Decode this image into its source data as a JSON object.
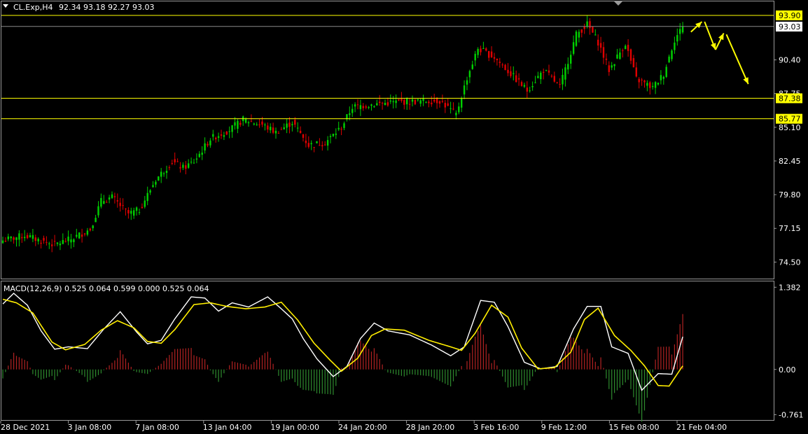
{
  "chart_data": [
    {
      "type": "candlestick",
      "symbol_header": "CL.Exp,H4",
      "ohlc_header": "92.34 93.18 92.27 93.03",
      "current_price": "93.03",
      "y_ticks": [
        "90.40",
        "87.75",
        "85.10",
        "82.45",
        "79.80",
        "77.15",
        "74.50"
      ],
      "ylim": [
        73.2,
        95.0
      ],
      "x_ticks": [
        "28 Dec 2021",
        "3 Jan 08:00",
        "7 Jan 08:00",
        "13 Jan 04:00",
        "19 Jan 00:00",
        "24 Jan 20:00",
        "28 Jan 20:00",
        "3 Feb 16:00",
        "9 Feb 12:00",
        "15 Feb 08:00",
        "21 Feb 04:00"
      ],
      "horizontal_levels": [
        {
          "label": "93.90",
          "value": 93.9
        },
        {
          "label": "87.38",
          "value": 87.38
        },
        {
          "label": "85.77",
          "value": 85.77
        }
      ],
      "close_path": [
        {
          "i": 0,
          "v": 76.2
        },
        {
          "i": 8,
          "v": 76.6
        },
        {
          "i": 15,
          "v": 76.1
        },
        {
          "i": 19,
          "v": 75.9
        },
        {
          "i": 25,
          "v": 76.3
        },
        {
          "i": 32,
          "v": 77.1
        },
        {
          "i": 36,
          "v": 79.3
        },
        {
          "i": 40,
          "v": 79.6
        },
        {
          "i": 46,
          "v": 78.3
        },
        {
          "i": 50,
          "v": 78.6
        },
        {
          "i": 56,
          "v": 81.0
        },
        {
          "i": 62,
          "v": 82.4
        },
        {
          "i": 66,
          "v": 81.9
        },
        {
          "i": 70,
          "v": 82.4
        },
        {
          "i": 76,
          "v": 84.2
        },
        {
          "i": 83,
          "v": 84.9
        },
        {
          "i": 88,
          "v": 85.7
        },
        {
          "i": 95,
          "v": 85.3
        },
        {
          "i": 100,
          "v": 84.7
        },
        {
          "i": 106,
          "v": 85.5
        },
        {
          "i": 112,
          "v": 83.7
        },
        {
          "i": 118,
          "v": 83.9
        },
        {
          "i": 124,
          "v": 85.1
        },
        {
          "i": 128,
          "v": 86.7
        },
        {
          "i": 135,
          "v": 86.9
        },
        {
          "i": 145,
          "v": 87.1
        },
        {
          "i": 160,
          "v": 87.2
        },
        {
          "i": 166,
          "v": 86.1
        },
        {
          "i": 170,
          "v": 89.0
        },
        {
          "i": 174,
          "v": 91.3
        },
        {
          "i": 180,
          "v": 90.6
        },
        {
          "i": 186,
          "v": 89.3
        },
        {
          "i": 192,
          "v": 88.0
        },
        {
          "i": 198,
          "v": 89.6
        },
        {
          "i": 204,
          "v": 88.3
        },
        {
          "i": 210,
          "v": 92.4
        },
        {
          "i": 214,
          "v": 93.2
        },
        {
          "i": 218,
          "v": 91.8
        },
        {
          "i": 222,
          "v": 89.6
        },
        {
          "i": 228,
          "v": 91.7
        },
        {
          "i": 232,
          "v": 88.9
        },
        {
          "i": 238,
          "v": 88.2
        },
        {
          "i": 242,
          "v": 89.3
        },
        {
          "i": 246,
          "v": 92.0
        },
        {
          "i": 249,
          "v": 93.03
        }
      ],
      "annotation_arrows": [
        [
          [
            252,
            92.6
          ],
          [
            256,
            93.4
          ]
        ],
        [
          [
            257,
            93.4
          ],
          [
            261,
            91.2
          ]
        ],
        [
          [
            261,
            91.2
          ],
          [
            264,
            92.5
          ]
        ],
        [
          [
            265,
            92.4
          ],
          [
            273,
            88.5
          ]
        ]
      ]
    },
    {
      "type": "macd",
      "label": "MACD(12,26,9) 0.525 0.064 0.599 0.000 0.525 0.064",
      "y_ticks": [
        "1.382",
        "0.00",
        "-0.761"
      ],
      "ylim": [
        -0.85,
        1.48
      ],
      "macd_line": [
        {
          "i": 0,
          "v": 1.1
        },
        {
          "i": 4,
          "v": 1.28
        },
        {
          "i": 9,
          "v": 1.08
        },
        {
          "i": 14,
          "v": 0.65
        },
        {
          "i": 19,
          "v": 0.34
        },
        {
          "i": 24,
          "v": 0.38
        },
        {
          "i": 31,
          "v": 0.35
        },
        {
          "i": 37,
          "v": 0.68
        },
        {
          "i": 43,
          "v": 0.97
        },
        {
          "i": 49,
          "v": 0.63
        },
        {
          "i": 53,
          "v": 0.43
        },
        {
          "i": 58,
          "v": 0.49
        },
        {
          "i": 63,
          "v": 0.85
        },
        {
          "i": 69,
          "v": 1.22
        },
        {
          "i": 74,
          "v": 1.2
        },
        {
          "i": 79,
          "v": 0.98
        },
        {
          "i": 84,
          "v": 1.12
        },
        {
          "i": 90,
          "v": 1.05
        },
        {
          "i": 97,
          "v": 1.22
        },
        {
          "i": 102,
          "v": 1.02
        },
        {
          "i": 106,
          "v": 0.85
        },
        {
          "i": 110,
          "v": 0.52
        },
        {
          "i": 115,
          "v": 0.18
        },
        {
          "i": 121,
          "v": -0.12
        },
        {
          "i": 126,
          "v": 0.05
        },
        {
          "i": 131,
          "v": 0.52
        },
        {
          "i": 136,
          "v": 0.78
        },
        {
          "i": 141,
          "v": 0.65
        },
        {
          "i": 149,
          "v": 0.58
        },
        {
          "i": 157,
          "v": 0.41
        },
        {
          "i": 164,
          "v": 0.23
        },
        {
          "i": 169,
          "v": 0.38
        },
        {
          "i": 175,
          "v": 1.16
        },
        {
          "i": 180,
          "v": 1.13
        },
        {
          "i": 185,
          "v": 0.72
        },
        {
          "i": 191,
          "v": 0.12
        },
        {
          "i": 197,
          "v": 0.01
        },
        {
          "i": 203,
          "v": 0.05
        },
        {
          "i": 209,
          "v": 0.68
        },
        {
          "i": 214,
          "v": 1.06
        },
        {
          "i": 219,
          "v": 1.06
        },
        {
          "i": 223,
          "v": 0.38
        },
        {
          "i": 229,
          "v": 0.27
        },
        {
          "i": 234,
          "v": -0.35
        },
        {
          "i": 240,
          "v": -0.07
        },
        {
          "i": 245,
          "v": -0.08
        },
        {
          "i": 249,
          "v": 0.55
        }
      ],
      "signal_line": [
        {
          "i": 0,
          "v": 1.18
        },
        {
          "i": 5,
          "v": 1.12
        },
        {
          "i": 11,
          "v": 0.95
        },
        {
          "i": 18,
          "v": 0.46
        },
        {
          "i": 23,
          "v": 0.33
        },
        {
          "i": 30,
          "v": 0.42
        },
        {
          "i": 36,
          "v": 0.66
        },
        {
          "i": 42,
          "v": 0.82
        },
        {
          "i": 48,
          "v": 0.7
        },
        {
          "i": 53,
          "v": 0.47
        },
        {
          "i": 58,
          "v": 0.44
        },
        {
          "i": 63,
          "v": 0.67
        },
        {
          "i": 70,
          "v": 1.09
        },
        {
          "i": 76,
          "v": 1.12
        },
        {
          "i": 82,
          "v": 1.06
        },
        {
          "i": 89,
          "v": 1.02
        },
        {
          "i": 96,
          "v": 1.05
        },
        {
          "i": 102,
          "v": 1.13
        },
        {
          "i": 108,
          "v": 0.83
        },
        {
          "i": 114,
          "v": 0.44
        },
        {
          "i": 120,
          "v": 0.15
        },
        {
          "i": 124,
          "v": -0.03
        },
        {
          "i": 130,
          "v": 0.19
        },
        {
          "i": 135,
          "v": 0.57
        },
        {
          "i": 140,
          "v": 0.68
        },
        {
          "i": 147,
          "v": 0.66
        },
        {
          "i": 156,
          "v": 0.49
        },
        {
          "i": 164,
          "v": 0.38
        },
        {
          "i": 168,
          "v": 0.32
        },
        {
          "i": 173,
          "v": 0.61
        },
        {
          "i": 179,
          "v": 1.08
        },
        {
          "i": 185,
          "v": 0.88
        },
        {
          "i": 190,
          "v": 0.36
        },
        {
          "i": 196,
          "v": 0.01
        },
        {
          "i": 202,
          "v": 0.03
        },
        {
          "i": 208,
          "v": 0.29
        },
        {
          "i": 213,
          "v": 0.84
        },
        {
          "i": 218,
          "v": 1.03
        },
        {
          "i": 224,
          "v": 0.57
        },
        {
          "i": 230,
          "v": 0.32
        },
        {
          "i": 235,
          "v": 0.06
        },
        {
          "i": 240,
          "v": -0.27
        },
        {
          "i": 244,
          "v": -0.28
        },
        {
          "i": 249,
          "v": 0.06
        }
      ]
    }
  ],
  "colors": {
    "background": "#000000",
    "bull": "#00d000",
    "bear": "#e00000",
    "level": "#ffff00",
    "current_line": "#8a8a8a",
    "macd": "#ffffff",
    "signal": "#ffee00",
    "hist_pos": "#b22222",
    "hist_neg": "#2e8b2e",
    "frame": "#9a9a9a"
  }
}
